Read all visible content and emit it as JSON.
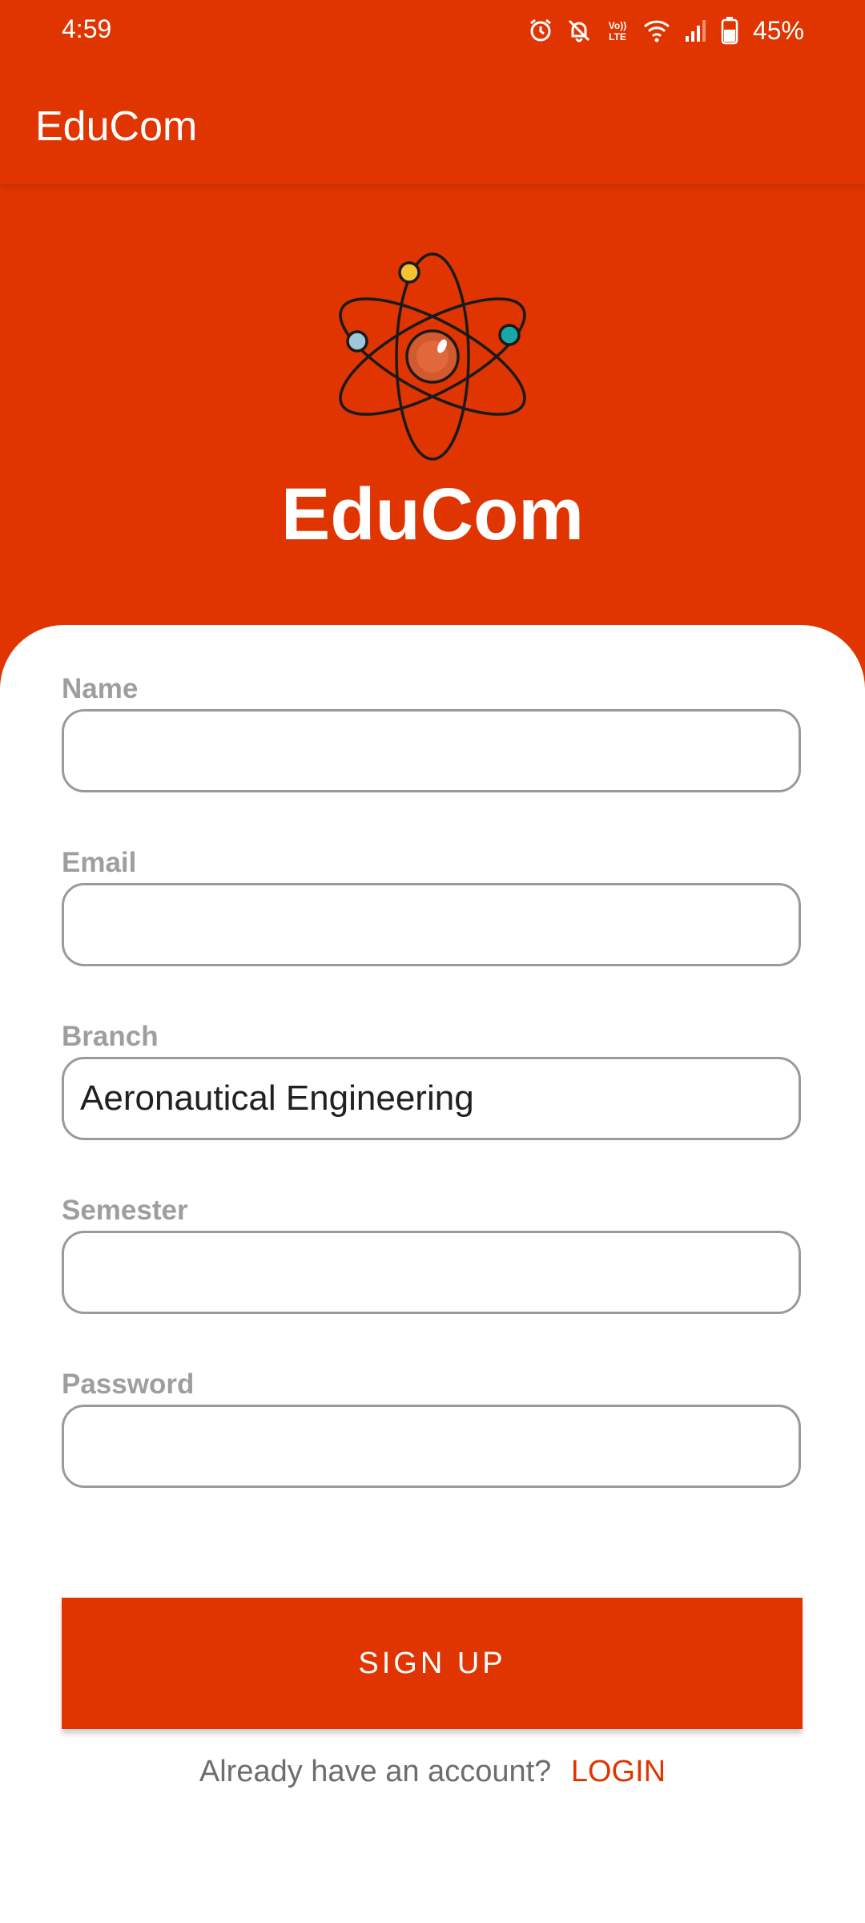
{
  "status_bar": {
    "time": "4:59",
    "battery_percent": "45%",
    "icons": [
      "alarm-icon",
      "bell-muted-icon",
      "volte-icon",
      "wifi-icon",
      "signal-icon",
      "battery-icon"
    ],
    "volte_label": "Vo))",
    "lte_label": "LTE"
  },
  "app_bar": {
    "title": "EduCom"
  },
  "header": {
    "brand_name": "EduCom",
    "logo_icon": "atom-icon"
  },
  "form": {
    "fields": [
      {
        "label": "Name",
        "value": ""
      },
      {
        "label": "Email",
        "value": ""
      },
      {
        "label": "Branch",
        "value": "Aeronautical Engineering"
      },
      {
        "label": "Semester",
        "value": ""
      },
      {
        "label": "Password",
        "value": ""
      }
    ],
    "signup_label": "SIGN UP",
    "login_prompt": "Already have an account?",
    "login_label": "LOGIN"
  },
  "colors": {
    "primary": "#E03500",
    "surface": "#FFFFFF",
    "label_gray": "#9E9E9E",
    "border_gray": "#9A9A9A"
  }
}
